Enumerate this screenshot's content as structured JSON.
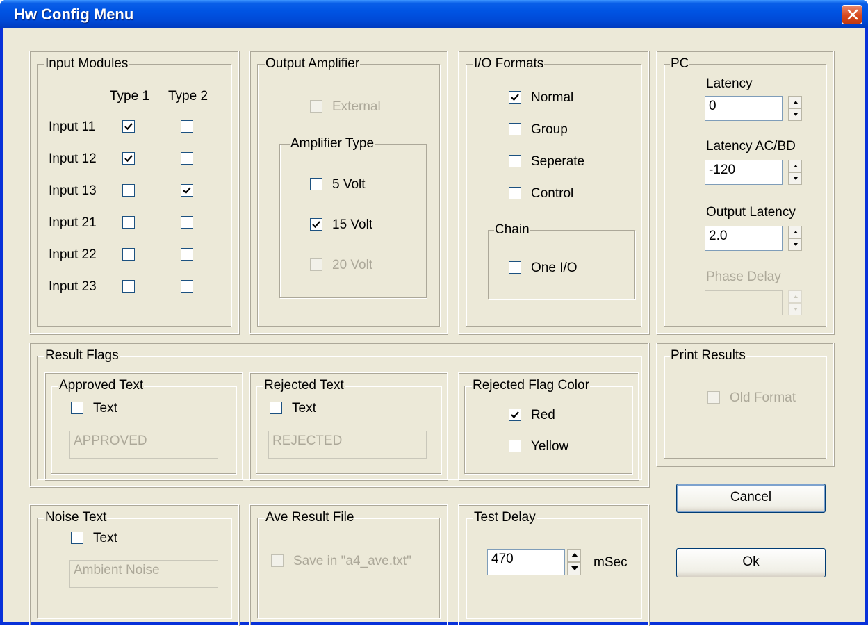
{
  "window": {
    "title": "Hw Config Menu"
  },
  "input_modules": {
    "legend": "Input Modules",
    "col1": "Type 1",
    "col2": "Type 2",
    "rows": [
      {
        "label": "Input 11",
        "type1": true,
        "type2": false
      },
      {
        "label": "Input 12",
        "type1": true,
        "type2": false
      },
      {
        "label": "Input 13",
        "type1": false,
        "type2": true
      },
      {
        "label": "Input 21",
        "type1": false,
        "type2": false
      },
      {
        "label": "Input 22",
        "type1": false,
        "type2": false
      },
      {
        "label": "Input 23",
        "type1": false,
        "type2": false
      }
    ]
  },
  "output_amplifier": {
    "legend": "Output Amplifier",
    "external": {
      "label": "External",
      "checked": false,
      "enabled": false
    },
    "amplifier_type": {
      "legend": "Amplifier Type",
      "options": [
        {
          "label": "5 Volt",
          "checked": false,
          "enabled": true
        },
        {
          "label": "15 Volt",
          "checked": true,
          "enabled": true
        },
        {
          "label": "20 Volt",
          "checked": false,
          "enabled": false
        }
      ]
    }
  },
  "io_formats": {
    "legend": "I/O Formats",
    "options": [
      {
        "label": "Normal",
        "checked": true
      },
      {
        "label": "Group",
        "checked": false
      },
      {
        "label": "Seperate",
        "checked": false
      },
      {
        "label": "Control",
        "checked": false
      }
    ],
    "chain": {
      "legend": "Chain",
      "one_io": {
        "label": "One I/O",
        "checked": false
      }
    }
  },
  "pc": {
    "legend": "PC",
    "latency": {
      "label": "Latency",
      "value": "0"
    },
    "latency_acbd": {
      "label": "Latency AC/BD",
      "value": "-120"
    },
    "output_latency": {
      "label": "Output Latency",
      "value": "2.0"
    },
    "phase_delay": {
      "label": "Phase Delay",
      "value": "",
      "enabled": false
    }
  },
  "result_flags": {
    "legend": "Result Flags",
    "approved": {
      "legend": "Approved  Text",
      "checkbox_label": "Text",
      "checked": false,
      "value": "APPROVED"
    },
    "rejected": {
      "legend": "Rejected Text",
      "checkbox_label": "Text",
      "checked": false,
      "value": "REJECTED"
    },
    "flag_color": {
      "legend": "Rejected Flag Color",
      "red": {
        "label": "Red",
        "checked": true
      },
      "yellow": {
        "label": "Yellow",
        "checked": false
      }
    }
  },
  "print_results": {
    "legend": "Print Results",
    "old_format": {
      "label": "Old Format",
      "checked": false,
      "enabled": false
    }
  },
  "noise_text": {
    "legend": "Noise Text",
    "checkbox_label": "Text",
    "checked": false,
    "value": "Ambient Noise"
  },
  "ave_result_file": {
    "legend": "Ave Result File",
    "save": {
      "label": "Save in \"a4_ave.txt\"",
      "checked": false,
      "enabled": false
    }
  },
  "test_delay": {
    "legend": "Test Delay",
    "value": "470",
    "unit": "mSec"
  },
  "buttons": {
    "cancel": "Cancel",
    "ok": "Ok"
  }
}
